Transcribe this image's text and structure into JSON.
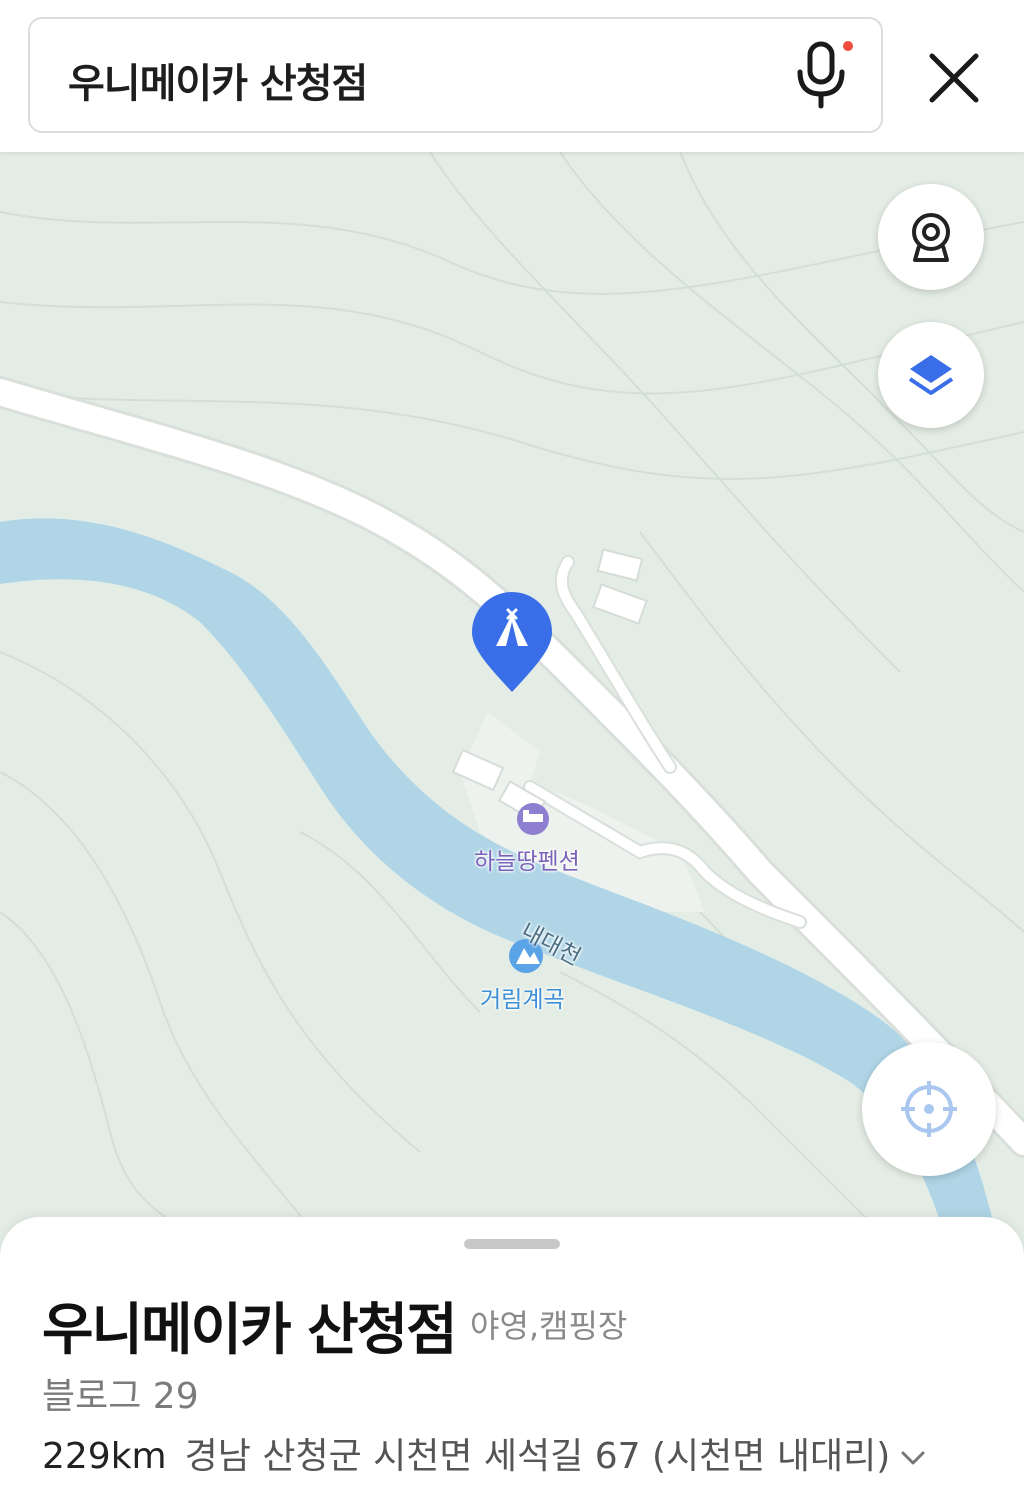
{
  "search": {
    "query": "우니메이카 산청점"
  },
  "map": {
    "labels": {
      "pension": "하늘땅펜션",
      "stream": "내대천",
      "valley": "거림계곡"
    },
    "colors": {
      "land": "#e4ede5",
      "river": "#afd5e6",
      "road": "#ffffff",
      "marker": "#3a6ee8",
      "pension_label": "#7a63b8",
      "valley_label": "#3d8fd6"
    }
  },
  "place": {
    "name": "우니메이카 산청점",
    "category": "야영,캠핑장",
    "blog": "블로그 29",
    "distance": "229km",
    "address": "경남 산청군 시천면 세석길 67 (시천면 내대리)"
  },
  "icons": [
    "mic-icon",
    "close-icon",
    "cctv-icon",
    "layers-icon",
    "my-location-icon",
    "tent-icon",
    "bed-icon",
    "mountain-icon",
    "chevron-down-icon"
  ]
}
